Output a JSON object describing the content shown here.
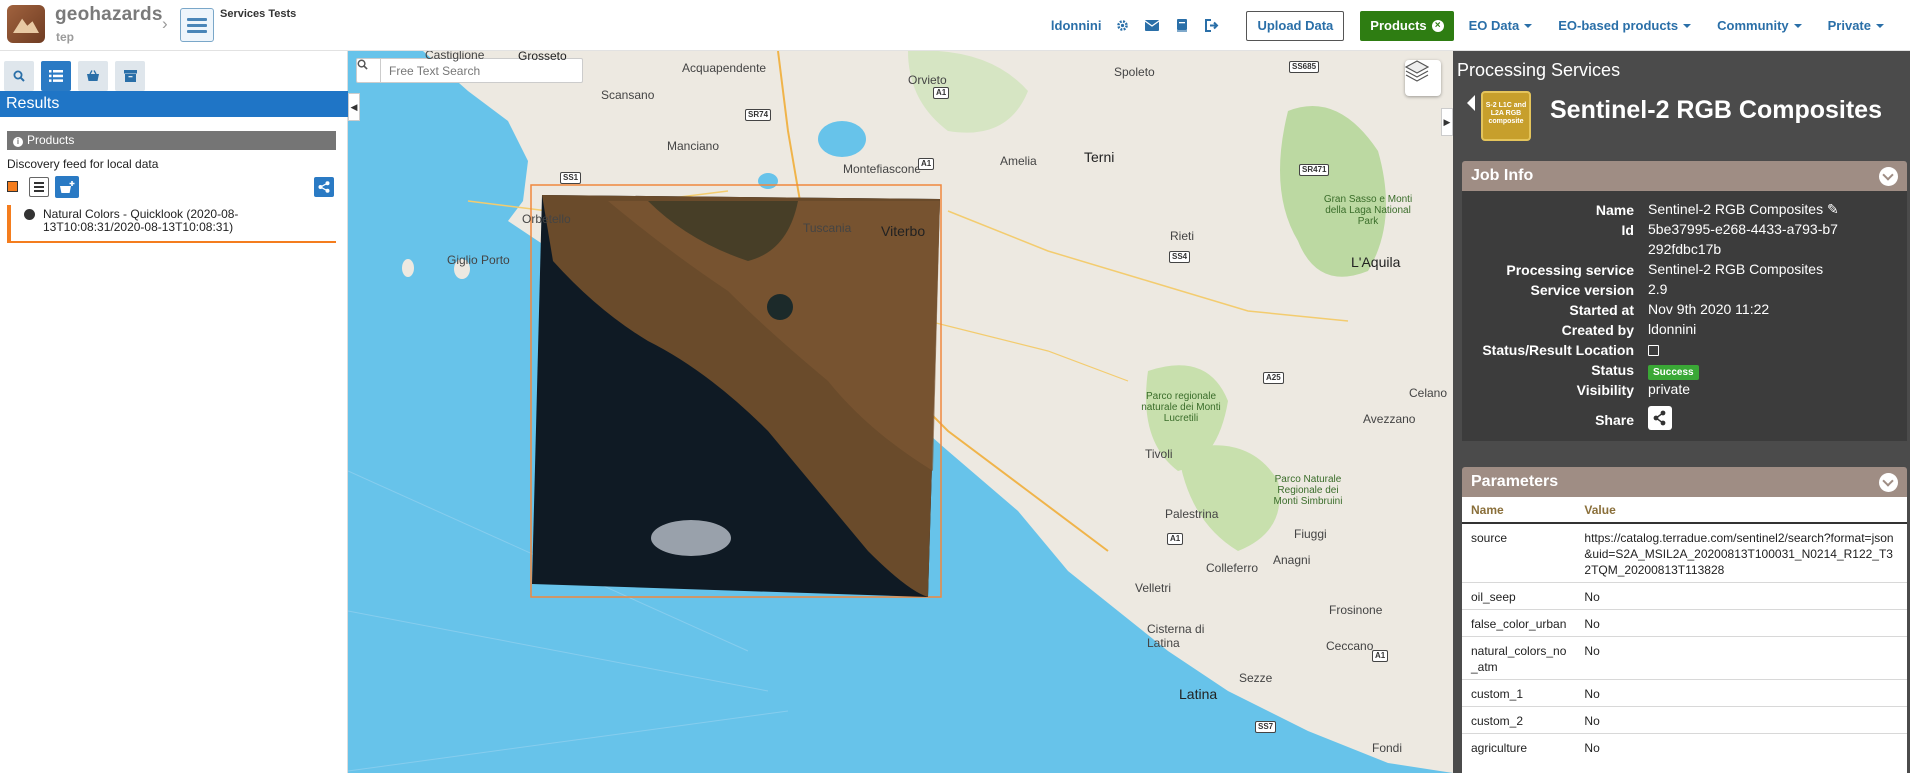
{
  "app": {
    "logo_text": "geohazards",
    "logo_sub": "tep",
    "context_title": "Services Tests"
  },
  "navbar": {
    "username": "ldonnini",
    "upload_label": "Upload Data",
    "products_label": "Products",
    "menus": [
      "EO Data",
      "EO-based products",
      "Community",
      "Private"
    ]
  },
  "left": {
    "results_title": "Results",
    "products_header": "Products",
    "feed_description": "Discovery feed for local data",
    "result_items": [
      {
        "title": "Natural Colors - Quicklook (2020-08-13T10:08:31/2020-08-13T10:08:31)"
      }
    ]
  },
  "map": {
    "search_placeholder": "Free Text Search",
    "cities": [
      "Castiglione",
      "Grosseto",
      "Acquapendente",
      "Orvieto",
      "Spoleto",
      "Scansano",
      "Manciano",
      "Montefiascone",
      "Amelia",
      "Terni",
      "Orbetello",
      "Viterbo",
      "Tuscania",
      "Giglio Porto",
      "Rieti",
      "L'Aquila",
      "Gran Sasso e Monti della Laga National Park",
      "Parco regionale naturale dei Monti Lucretili",
      "Celano",
      "Avezzano",
      "Tivoli",
      "Palestrina",
      "Parco Naturale Regionale dei Monti Simbruini",
      "Fiuggi",
      "Anagni",
      "Colleferro",
      "Velletri",
      "Frosinone",
      "Cisterna di Latina",
      "Ceccano",
      "Sezze",
      "Latina",
      "Fondi"
    ],
    "roads": [
      "SS685",
      "SR74",
      "A1",
      "A1",
      "SR471",
      "SS1",
      "SS4",
      "A25",
      "A1",
      "A1",
      "SS7"
    ],
    "colors": {
      "sea": "#67c3ea",
      "land": "#ede9e1",
      "footprint": "#f0883e"
    }
  },
  "right": {
    "panel_title": "Processing Services",
    "service_name": "Sentinel-2 RGB Composites",
    "service_logo_text": "S-2 L1C and L2A RGB composite",
    "job_info": {
      "title": "Job Info",
      "rows": [
        {
          "key": "Name",
          "value": "Sentinel-2 RGB Composites"
        },
        {
          "key": "Id",
          "value": "5be37995-e268-4433-a793-b7292fdbc17b"
        },
        {
          "key": "Processing service",
          "value": "Sentinel-2 RGB Composites"
        },
        {
          "key": "Service version",
          "value": "2.9"
        },
        {
          "key": "Started at",
          "value": "Nov 9th 2020 11:22"
        },
        {
          "key": "Created by",
          "value": "ldonnini"
        },
        {
          "key": "Status/Result Location",
          "value": ""
        },
        {
          "key": "Status",
          "value": "Success"
        },
        {
          "key": "Visibility",
          "value": "private"
        },
        {
          "key": "Share",
          "value": ""
        }
      ]
    },
    "parameters": {
      "title": "Parameters",
      "col_name": "Name",
      "col_value": "Value",
      "rows": [
        {
          "name": "source",
          "value": "https://catalog.terradue.com/sentinel2/search?format=json&uid=S2A_MSIL2A_20200813T100031_N0214_R122_T32TQM_20200813T113828"
        },
        {
          "name": "oil_seep",
          "value": "No"
        },
        {
          "name": "false_color_urban",
          "value": "No"
        },
        {
          "name": "natural_colors_no_atm",
          "value": "No"
        },
        {
          "name": "custom_1",
          "value": "No"
        },
        {
          "name": "custom_2",
          "value": "No"
        },
        {
          "name": "agriculture",
          "value": "No"
        }
      ]
    }
  }
}
